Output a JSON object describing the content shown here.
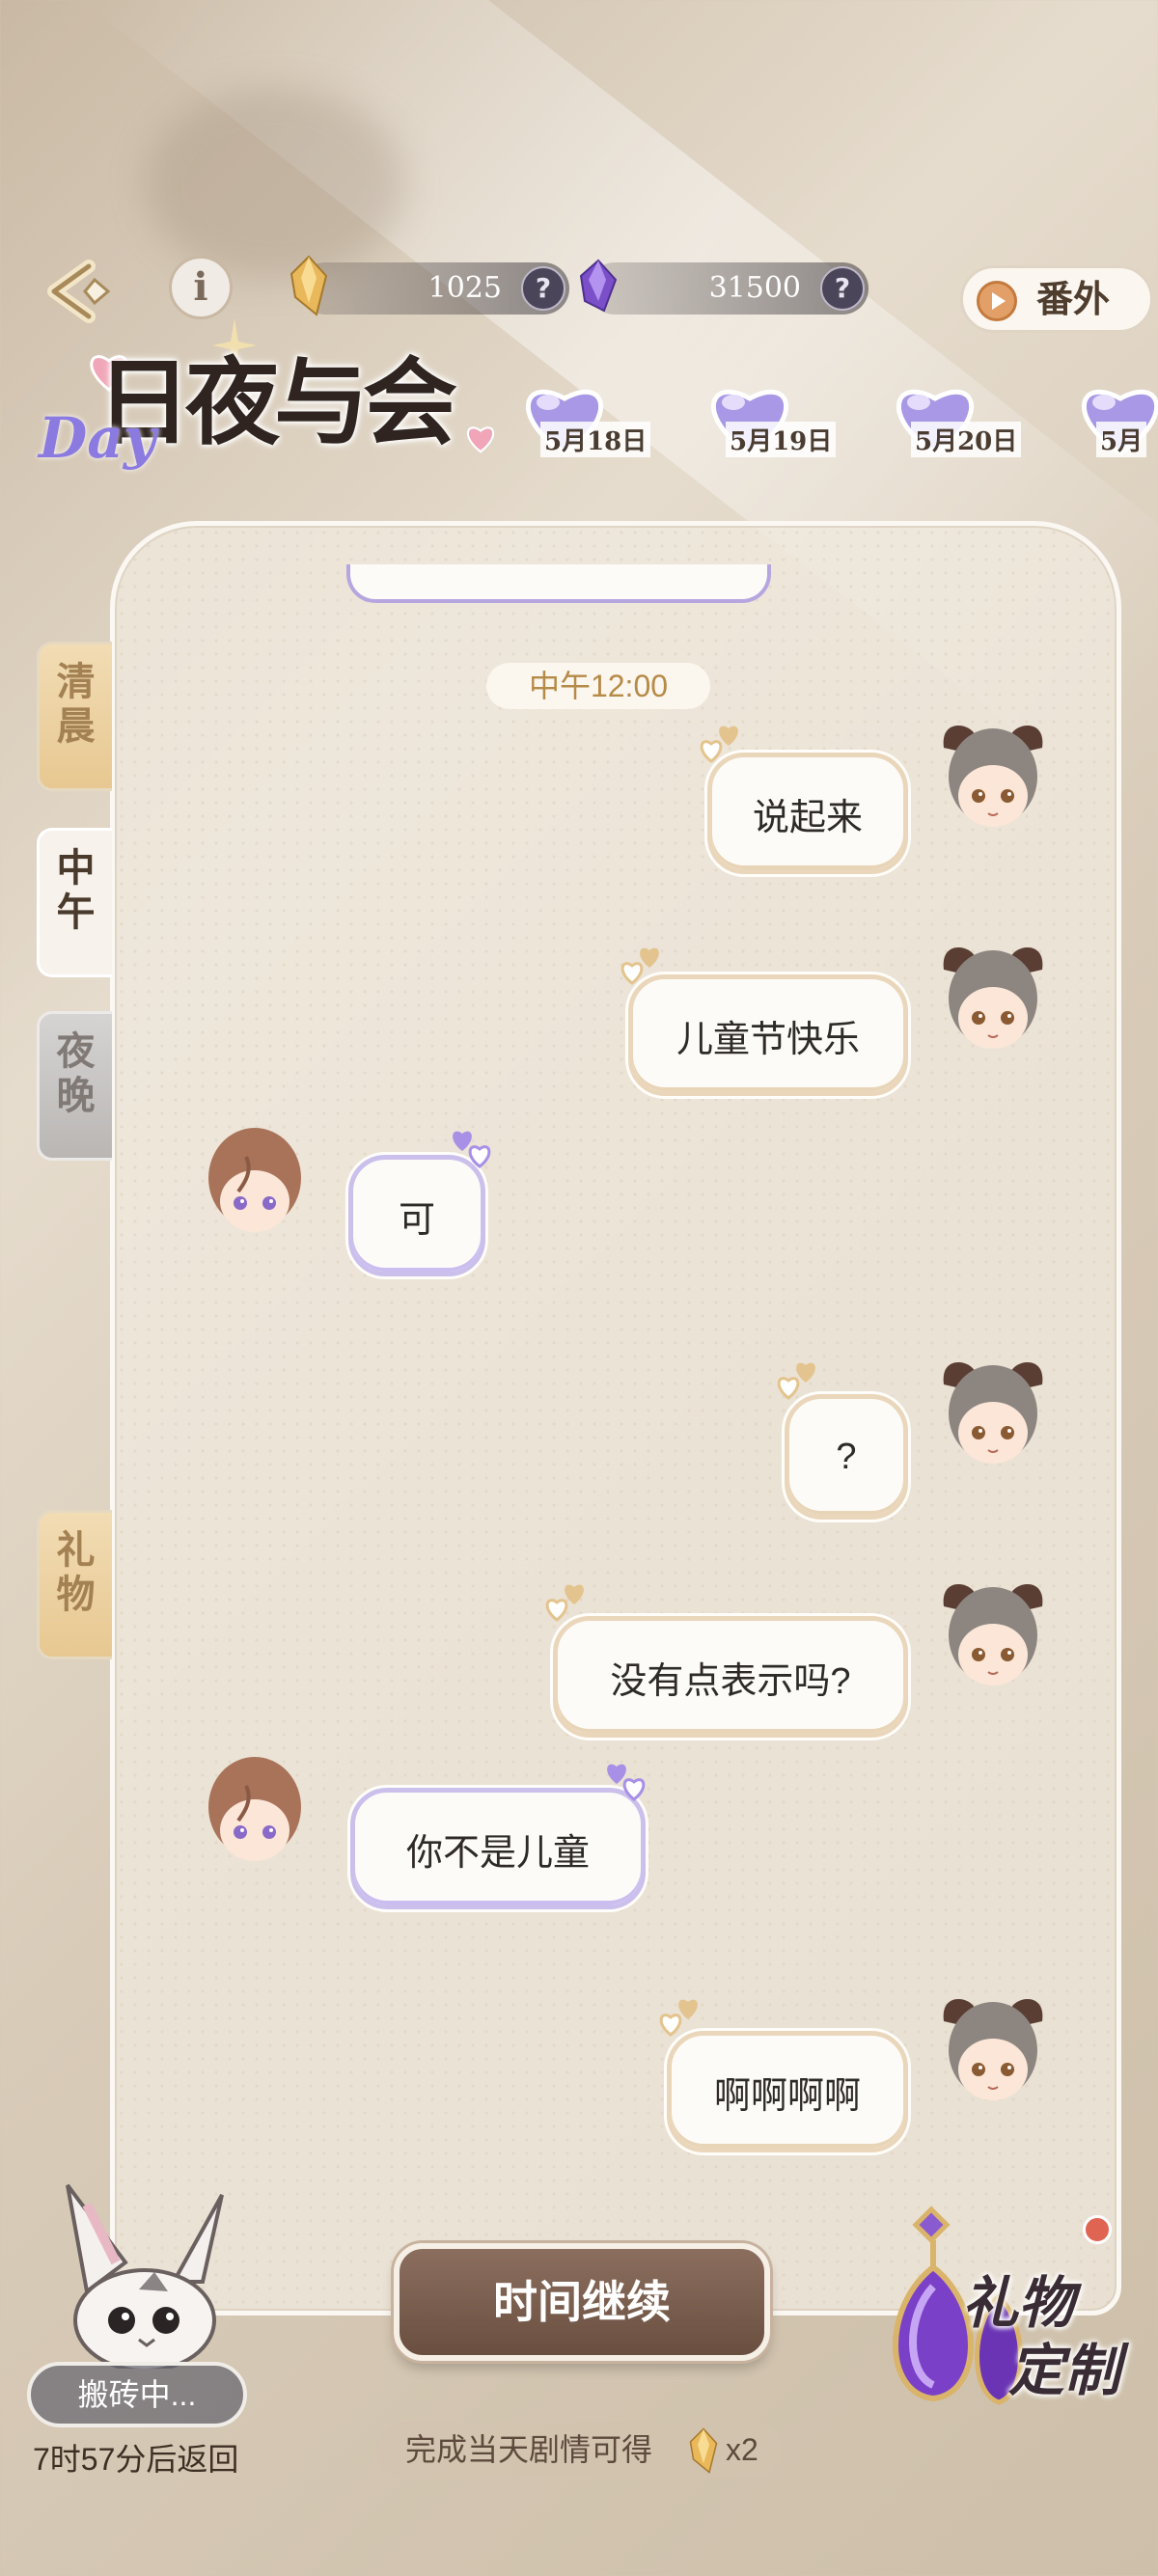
{
  "header": {
    "gold_currency": "1025",
    "purple_currency": "31500",
    "help_label": "?",
    "info_label": "i",
    "extra_button": "番外"
  },
  "logo": {
    "title": "日夜与会",
    "subtitle": "Day"
  },
  "dates": [
    "5月18日",
    "5月19日",
    "5月20日",
    "5月"
  ],
  "side_tabs": {
    "morning": "清晨",
    "noon": "中午",
    "night": "夜晚",
    "gift": "礼物"
  },
  "chat": {
    "time_label": "中午12:00",
    "messages": [
      {
        "side": "right",
        "text": "说起来"
      },
      {
        "side": "right",
        "text": "儿童节快乐"
      },
      {
        "side": "left",
        "text": "可"
      },
      {
        "side": "right",
        "text": "?"
      },
      {
        "side": "right",
        "text": "没有点表示吗?"
      },
      {
        "side": "left",
        "text": "你不是儿童"
      },
      {
        "side": "right",
        "text": "啊啊啊啊"
      }
    ]
  },
  "bottom": {
    "continue_button": "时间继续",
    "reward_note": "完成当天剧情可得",
    "reward_multiplier": "x2",
    "status": "搬砖中...",
    "return_time": "7时57分后返回",
    "gift_custom_line1": "礼物",
    "gift_custom_line2": "定制"
  },
  "colors": {
    "accent_gold": "#e8c591",
    "accent_purple": "#8b7be0",
    "button_brown": "#7a5e4e",
    "notification_red": "#e06452"
  }
}
